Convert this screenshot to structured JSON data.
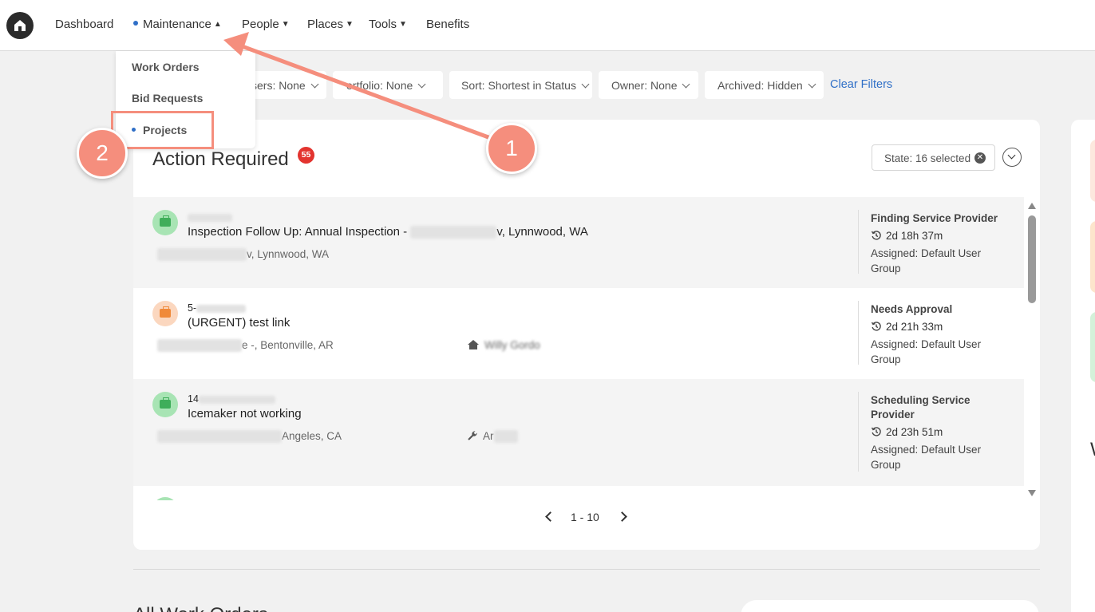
{
  "nav": {
    "items": [
      {
        "label": "Dashboard",
        "caret": false,
        "active": false
      },
      {
        "label": "Maintenance",
        "caret": true,
        "active": true
      },
      {
        "label": "People",
        "caret": true,
        "active": false
      },
      {
        "label": "Places",
        "caret": true,
        "active": false
      },
      {
        "label": "Tools",
        "caret": true,
        "active": false
      },
      {
        "label": "Benefits",
        "caret": false,
        "active": false
      }
    ]
  },
  "dropdown": {
    "items": [
      "Work Orders",
      "Bid Requests",
      "Projects"
    ],
    "active": "Projects"
  },
  "filters": {
    "users": "sers: None",
    "portfolio": "ortfolio: None",
    "sort": "Sort: Shortest in Status",
    "owner": "Owner: None",
    "archived": "Archived: Hidden",
    "clear": "Clear Filters"
  },
  "action_required": {
    "title": "Action Required",
    "count": "55",
    "state_filter": "State: 16 selected",
    "rows": [
      {
        "id": "",
        "title": "Inspection Follow Up: Annual Inspection -",
        "title_suffix": "v, Lynnwood, WA",
        "address": "v, Lynnwood, WA",
        "extra": "",
        "status": "Finding Service Provider",
        "time": "2d 18h 37m",
        "assigned": "Assigned: Default User Group"
      },
      {
        "id": "5-",
        "title": "(URGENT) test link",
        "title_suffix": "",
        "address": "e -, Bentonville, AR",
        "extra": "Willy Gordo",
        "status": "Needs Approval",
        "time": "2d 21h 33m",
        "assigned": "Assigned: Default User Group"
      },
      {
        "id": "14",
        "title": "Icemaker not working",
        "title_suffix": "",
        "address": "Angeles, CA",
        "extra": "Ar",
        "status": "Scheduling Service Provider",
        "time": "2d 23h 51m",
        "assigned": "Assigned: Default User Group"
      }
    ],
    "pager": "1 - 10"
  },
  "bottom": {
    "heading": "All Work Orders"
  },
  "right_panel": {
    "letter": "W"
  },
  "annotations": {
    "step1": "1",
    "step2": "2"
  },
  "colors": {
    "accent": "#2f6fc7",
    "badge": "#e3342f",
    "annotation": "#f58e7d"
  }
}
